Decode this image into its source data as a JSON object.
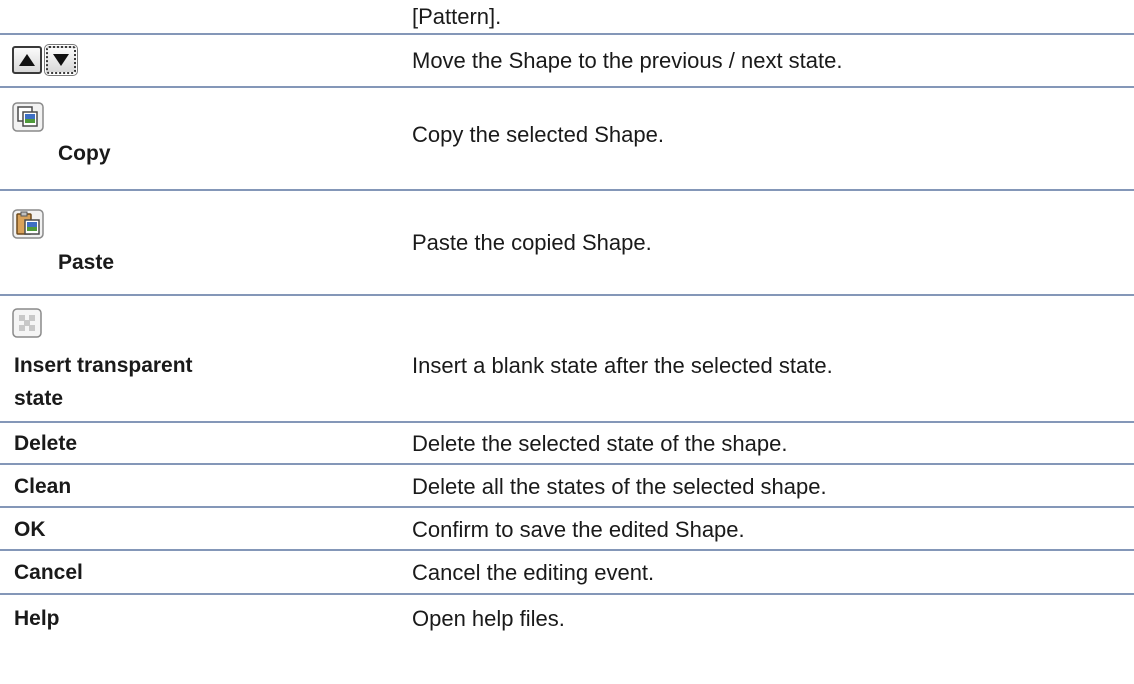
{
  "rows": [
    {
      "label": "",
      "desc": "[Pattern]."
    },
    {
      "label": "",
      "icons": [
        "up-arrow-icon",
        "down-arrow-icon"
      ],
      "desc": "Move the Shape to the previous / next state."
    },
    {
      "label": "Copy",
      "icon": "copy-icon",
      "desc": "Copy the selected Shape."
    },
    {
      "label": "Paste",
      "icon": "paste-icon",
      "desc": "Paste the copied Shape."
    },
    {
      "label_line1": "Insert transparent",
      "label_line2": "state",
      "icon": "transparent-state-icon",
      "desc": "Insert a blank state after the selected state."
    },
    {
      "label": "Delete",
      "desc": "Delete the selected state of the shape."
    },
    {
      "label": "Clean",
      "desc": "Delete all the states of the selected shape."
    },
    {
      "label": "OK",
      "desc": "Confirm to save the edited Shape."
    },
    {
      "label": "Cancel",
      "desc": "Cancel the editing event."
    },
    {
      "label": "Help",
      "desc": "Open help files."
    }
  ],
  "colors": {
    "rule": "#8497b8",
    "text": "#1a1a1a"
  }
}
